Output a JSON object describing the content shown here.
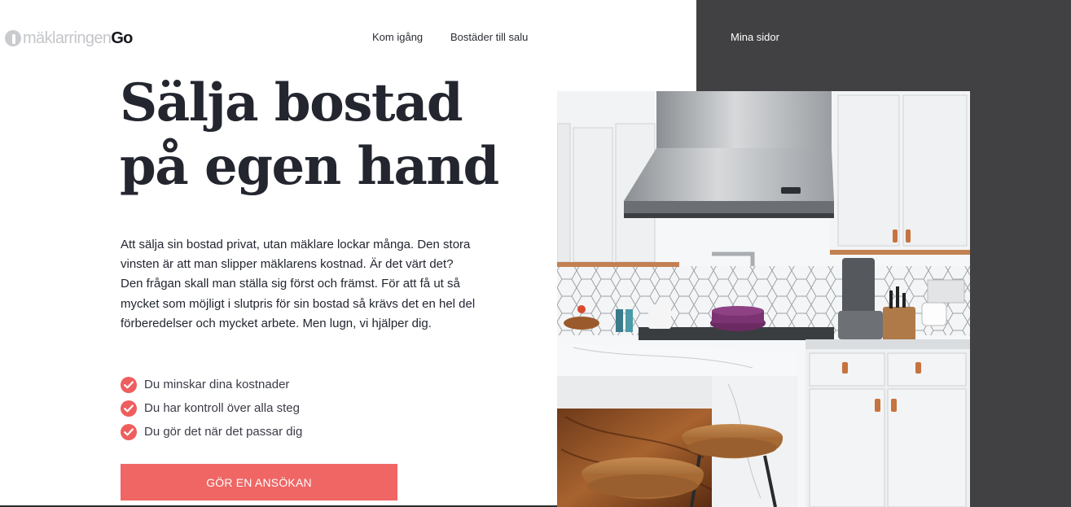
{
  "header": {
    "logo_text": "mäklarringen",
    "logo_suffix": "Go",
    "nav": {
      "kom_igang": "Kom igång",
      "bostader": "Bostäder till salu",
      "mina_sidor": "Mina sidor"
    }
  },
  "hero": {
    "title_line1": "Sälja bostad",
    "title_line2": "på egen hand",
    "intro": "Att sälja sin bostad privat, utan mäklare lockar många. Den stora vinsten är att man slipper mäklarens kostnad. Är det värt det? Den frågan skall man ställa sig först och främst. För att få ut så mycket som möjligt i slutpris för sin bostad så krävs det en hel del förberedelser och mycket arbete. Men lugn, vi hjälper dig.",
    "benefits": [
      "Du minskar dina kostnader",
      "Du har kontroll över alla steg",
      "Du gör det när det passar dig"
    ],
    "cta_label": "GÖR EN ANSÖKAN"
  },
  "colors": {
    "accent": "#ef6664",
    "dark_panel": "#414143",
    "heading": "#23262e"
  },
  "icons": {
    "benefit": "check-circle-icon",
    "logo": "maklarringen-logo-icon"
  }
}
